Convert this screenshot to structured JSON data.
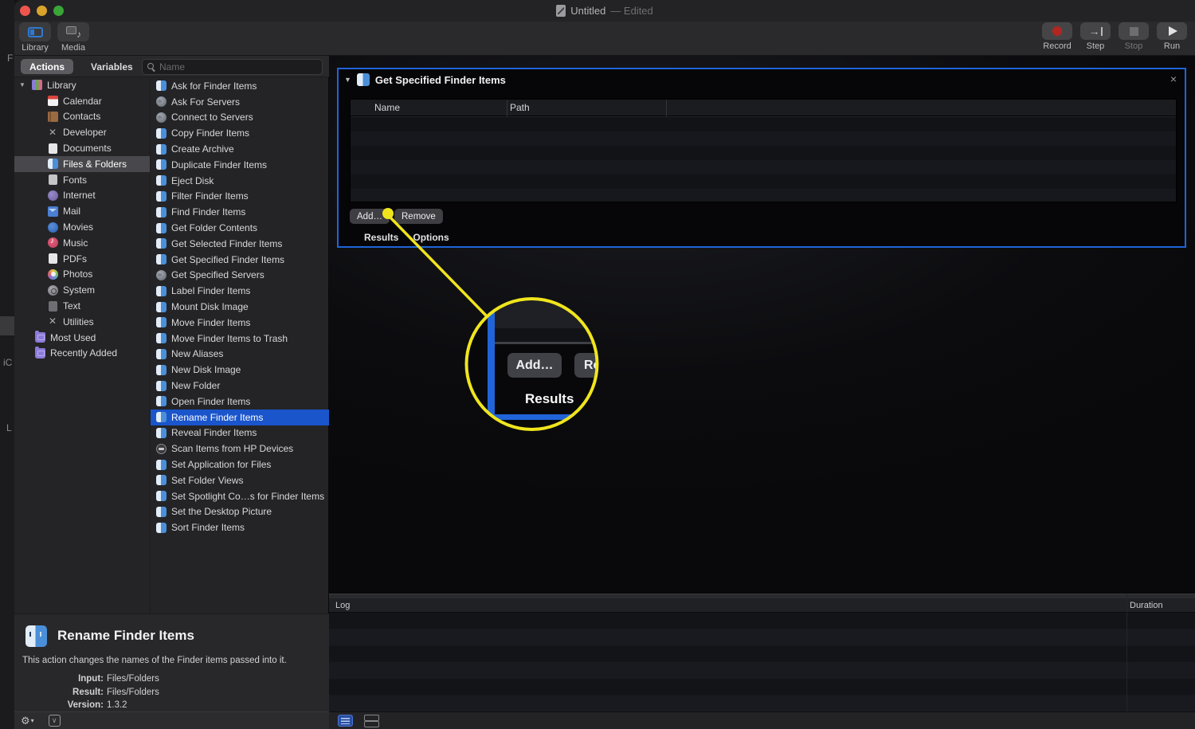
{
  "window": {
    "title": "Untitled",
    "state": "— Edited"
  },
  "toolbar": {
    "library_label": "Library",
    "media_label": "Media",
    "record_label": "Record",
    "step_label": "Step",
    "stop_label": "Stop",
    "run_label": "Run"
  },
  "panel_tabs": {
    "actions": "Actions",
    "variables": "Variables",
    "search_placeholder": "Name"
  },
  "sidebar": {
    "items": [
      {
        "label": "Library",
        "icon": "library",
        "level": 0,
        "disclosure": true,
        "selected": false
      },
      {
        "label": "Calendar",
        "icon": "calendar",
        "level": 2,
        "selected": false
      },
      {
        "label": "Contacts",
        "icon": "contacts",
        "level": 2,
        "selected": false
      },
      {
        "label": "Developer",
        "icon": "developer",
        "level": 2,
        "selected": false
      },
      {
        "label": "Documents",
        "icon": "documents",
        "level": 2,
        "selected": false
      },
      {
        "label": "Files & Folders",
        "icon": "finder",
        "level": 2,
        "selected": true
      },
      {
        "label": "Fonts",
        "icon": "fonts",
        "level": 2,
        "selected": false
      },
      {
        "label": "Internet",
        "icon": "internet",
        "level": 2,
        "selected": false
      },
      {
        "label": "Mail",
        "icon": "mail",
        "level": 2,
        "selected": false
      },
      {
        "label": "Movies",
        "icon": "movies",
        "level": 2,
        "selected": false
      },
      {
        "label": "Music",
        "icon": "music",
        "level": 2,
        "selected": false
      },
      {
        "label": "PDFs",
        "icon": "pdfs",
        "level": 2,
        "selected": false
      },
      {
        "label": "Photos",
        "icon": "photos",
        "level": 2,
        "selected": false
      },
      {
        "label": "System",
        "icon": "system",
        "level": 2,
        "selected": false
      },
      {
        "label": "Text",
        "icon": "text",
        "level": 2,
        "selected": false
      },
      {
        "label": "Utilities",
        "icon": "utilities",
        "level": 2,
        "selected": false
      },
      {
        "label": "Most Used",
        "icon": "folder",
        "level": 1,
        "selected": false
      },
      {
        "label": "Recently Added",
        "icon": "folder",
        "level": 1,
        "selected": false
      }
    ]
  },
  "actions_list": {
    "items": [
      {
        "label": "Ask for Finder Items",
        "icon": "finder",
        "selected": false
      },
      {
        "label": "Ask For Servers",
        "icon": "server",
        "selected": false
      },
      {
        "label": "Connect to Servers",
        "icon": "server",
        "selected": false
      },
      {
        "label": "Copy Finder Items",
        "icon": "finder",
        "selected": false
      },
      {
        "label": "Create Archive",
        "icon": "finder",
        "selected": false
      },
      {
        "label": "Duplicate Finder Items",
        "icon": "finder",
        "selected": false
      },
      {
        "label": "Eject Disk",
        "icon": "finder",
        "selected": false
      },
      {
        "label": "Filter Finder Items",
        "icon": "finder",
        "selected": false
      },
      {
        "label": "Find Finder Items",
        "icon": "finder",
        "selected": false
      },
      {
        "label": "Get Folder Contents",
        "icon": "finder",
        "selected": false
      },
      {
        "label": "Get Selected Finder Items",
        "icon": "finder",
        "selected": false
      },
      {
        "label": "Get Specified Finder Items",
        "icon": "finder",
        "selected": false
      },
      {
        "label": "Get Specified Servers",
        "icon": "server",
        "selected": false
      },
      {
        "label": "Label Finder Items",
        "icon": "finder",
        "selected": false
      },
      {
        "label": "Mount Disk Image",
        "icon": "finder",
        "selected": false
      },
      {
        "label": "Move Finder Items",
        "icon": "finder",
        "selected": false
      },
      {
        "label": "Move Finder Items to Trash",
        "icon": "finder",
        "selected": false
      },
      {
        "label": "New Aliases",
        "icon": "finder",
        "selected": false
      },
      {
        "label": "New Disk Image",
        "icon": "finder",
        "selected": false
      },
      {
        "label": "New Folder",
        "icon": "finder",
        "selected": false
      },
      {
        "label": "Open Finder Items",
        "icon": "finder",
        "selected": false
      },
      {
        "label": "Rename Finder Items",
        "icon": "finder",
        "selected": true
      },
      {
        "label": "Reveal Finder Items",
        "icon": "finder",
        "selected": false
      },
      {
        "label": "Scan Items from HP Devices",
        "icon": "scanner",
        "selected": false
      },
      {
        "label": "Set Application for Files",
        "icon": "finder",
        "selected": false
      },
      {
        "label": "Set Folder Views",
        "icon": "finder",
        "selected": false
      },
      {
        "label": "Set Spotlight Co…s for Finder Items",
        "icon": "finder",
        "selected": false
      },
      {
        "label": "Set the Desktop Picture",
        "icon": "finder",
        "selected": false
      },
      {
        "label": "Sort Finder Items",
        "icon": "finder",
        "selected": false
      }
    ]
  },
  "workflow_card": {
    "title": "Get Specified Finder Items",
    "close": "×",
    "columns": {
      "name": "Name",
      "path": "Path"
    },
    "add_button": "Add…",
    "remove_button": "Remove",
    "results_tab": "Results",
    "options_tab": "Options"
  },
  "callout": {
    "color": "#f0e51d",
    "add_label": "Add…",
    "remove_partial": "Re",
    "results_label": "Results"
  },
  "log_panel": {
    "log_header": "Log",
    "duration_header": "Duration"
  },
  "info_panel": {
    "title": "Rename Finder Items",
    "description": "This action changes the names of the Finder items passed into it.",
    "fields": [
      {
        "label": "Input:",
        "value": "Files/Folders"
      },
      {
        "label": "Result:",
        "value": "Files/Folders"
      },
      {
        "label": "Version:",
        "value": "1.3.2"
      }
    ]
  },
  "background_window": {
    "fragments": {
      "f1": "F",
      "f2": "iC",
      "f3": "L"
    }
  },
  "icons": [
    "traffic-light-close",
    "traffic-light-minimize",
    "traffic-light-zoom",
    "document-icon",
    "library-sidebar-icon",
    "media-icon",
    "record-icon",
    "step-icon",
    "stop-icon",
    "run-icon",
    "search-icon",
    "disclosure-triangle-icon",
    "finder-icon",
    "close-icon",
    "gear-icon",
    "chevron-down-icon",
    "list-view-icon",
    "panes-view-icon"
  ]
}
